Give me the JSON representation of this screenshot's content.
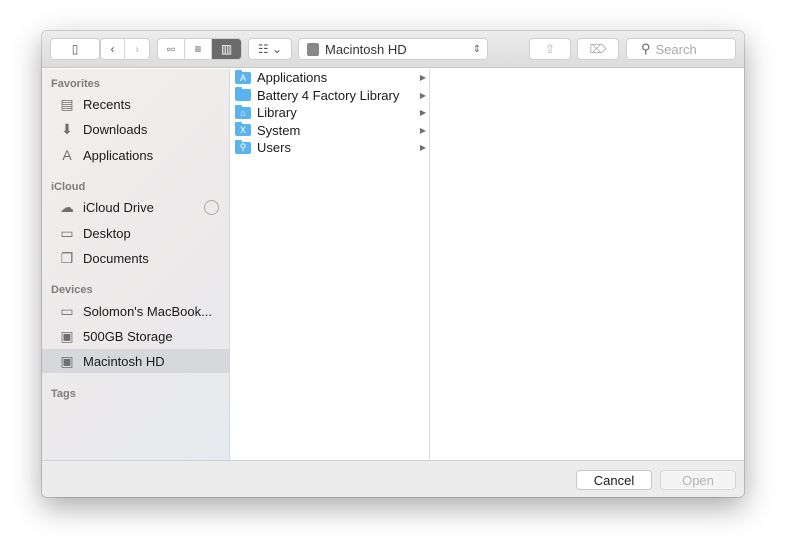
{
  "toolbar": {
    "location": "Macintosh HD",
    "search_placeholder": "Search"
  },
  "sidebar": {
    "favorites_label": "Favorites",
    "favorites": [
      "Recents",
      "Downloads",
      "Applications"
    ],
    "icloud_label": "iCloud",
    "icloud": [
      "iCloud Drive",
      "Desktop",
      "Documents"
    ],
    "devices_label": "Devices",
    "devices": [
      "Solomon's MacBook...",
      "500GB Storage",
      "Macintosh HD"
    ],
    "tags_label": "Tags"
  },
  "column": [
    {
      "name": "Applications",
      "glyph": "A"
    },
    {
      "name": "Battery 4 Factory Library",
      "glyph": ""
    },
    {
      "name": "Library",
      "glyph": "⌂"
    },
    {
      "name": "System",
      "glyph": "X"
    },
    {
      "name": "Users",
      "glyph": "⚲"
    }
  ],
  "footer": {
    "cancel": "Cancel",
    "open": "Open"
  }
}
